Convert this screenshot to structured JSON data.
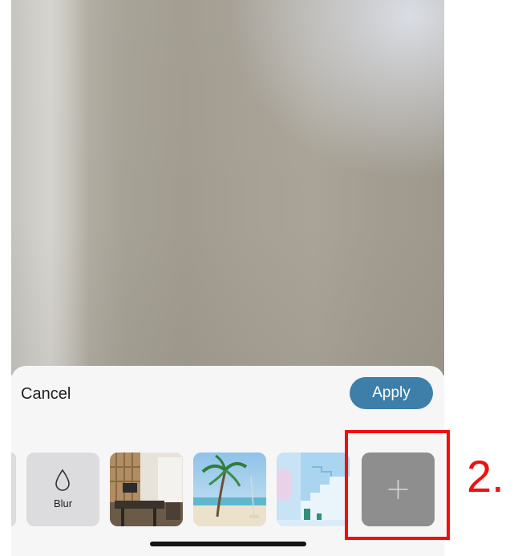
{
  "preview": {
    "description_icon": "camera-preview"
  },
  "sheet": {
    "cancel_label": "Cancel",
    "apply_label": "Apply",
    "backgrounds": [
      {
        "id": "partial",
        "icon": "background-thumbnail"
      },
      {
        "id": "blur",
        "icon": "droplet-icon",
        "label": "Blur"
      },
      {
        "id": "office",
        "icon": "office-background-thumbnail"
      },
      {
        "id": "beach",
        "icon": "beach-background-thumbnail"
      },
      {
        "id": "stairs",
        "icon": "stairs-background-thumbnail"
      },
      {
        "id": "add",
        "icon": "plus-icon"
      }
    ]
  },
  "annotation": {
    "step_label": "2.",
    "highlight_color": "#f20d0d"
  },
  "colors": {
    "accent": "#3d7fa8",
    "sheet_background": "#f6f6f7",
    "add_tile": "#8e8e8e"
  }
}
